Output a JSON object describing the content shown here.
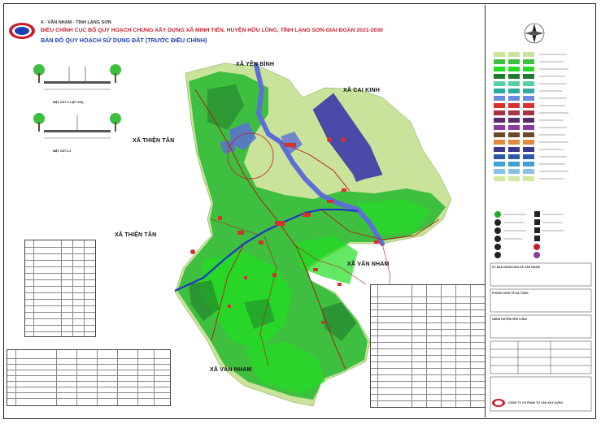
{
  "header": {
    "line1": "X - VĂN NHAM - TỈNH LẠNG SƠN",
    "line2": "ĐIỀU CHỈNH CỤC BỘ QUY HOẠCH CHUNG XÂY DỰNG XÃ MINH TIẾN, HUYỆN HỮU LŨNG, TỈNH LẠNG SƠN GIAI ĐOẠN 2021-2030",
    "line3": "BẢN ĐỒ QUY HOẠCH SỬ DỤNG ĐẤT (TRƯỚC ĐIỀU CHỈNH)"
  },
  "places": {
    "yen_binh": "XÃ YÊN BÌNH",
    "cai_kinh": "XÃ CAI KINH",
    "thien_tan_1": "XÃ THIỆN TÂN",
    "thien_tan_2": "XÃ THIỆN TÂN",
    "van_nham_1": "XÃ VÂN NHAM",
    "van_nham_2": "XÃ VÂN NHAM"
  },
  "cross_sections": {
    "label_1": "MẶT CẮT 1-1 (ĐT 242)",
    "label_2": "MẶT CẮT 2-2"
  },
  "approval": {
    "block1": "ỦY BAN NHÂN DÂN XÃ VÂN NHAM",
    "block2": "PHÒNG KINH TẾ HẠ TẦNG",
    "block3": "UBND HUYỆN HỮU LŨNG",
    "company": "CÔNG TY CỔ PHẦN TƯ VẤN XÂY DỰNG"
  },
  "colors": {
    "land_light": "#c9e39b",
    "land_green": "#3fbf3f",
    "land_bright": "#22dd22",
    "forest_dark": "#1f7a2c",
    "water": "#5b6fd6",
    "industrial": "#4a4aa8",
    "road": "#b11c1c",
    "highway": "#1e36c8",
    "residential": "#d8312f"
  }
}
